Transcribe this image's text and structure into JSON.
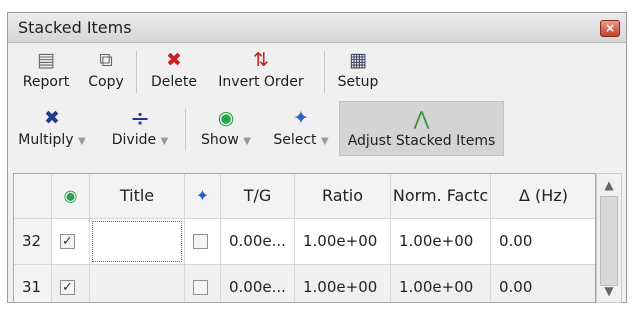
{
  "window": {
    "title": "Stacked Items",
    "close_glyph": "×"
  },
  "toolbar1": [
    {
      "label": "Report",
      "icon": "report-icon",
      "glyph": "▤"
    },
    {
      "label": "Copy",
      "icon": "copy-icon",
      "glyph": "⧉"
    },
    {
      "label": "Delete",
      "icon": "delete-icon",
      "glyph": "✖",
      "color": "#cc1f1f"
    },
    {
      "label": "Invert Order",
      "icon": "invert-order-icon",
      "glyph": "⇅",
      "color": "#c62020"
    },
    {
      "label": "Setup",
      "icon": "setup-icon",
      "glyph": "▦"
    }
  ],
  "toolbar2": [
    {
      "label": "Multiply",
      "icon": "multiply-icon",
      "glyph": "✖",
      "color": "#1f3c88",
      "dropdown": true
    },
    {
      "label": "Divide",
      "icon": "divide-icon",
      "glyph": "÷",
      "color": "#1f3c88",
      "dropdown": true
    },
    {
      "label": "Show",
      "icon": "eye-icon",
      "glyph": "◉",
      "color": "#2aa34a",
      "dropdown": true
    },
    {
      "label": "Select",
      "icon": "pin-icon",
      "glyph": "✦",
      "color": "#2c5cc5",
      "dropdown": true
    },
    {
      "label": "Adjust Stacked Items",
      "icon": "adjust-spectra-icon",
      "glyph": "⋀",
      "color": "#3a8a3a",
      "active": true
    }
  ],
  "dropdown_glyph": "▼",
  "table": {
    "headers": [
      "",
      "",
      "Title",
      "",
      "T/G",
      "Ratio",
      "Norm. Factc",
      "Δ (Hz)"
    ],
    "header_icons": {
      "visible": "eye-icon",
      "pin": "pin-icon"
    },
    "rows": [
      {
        "index": "32",
        "visible": true,
        "title": "",
        "pinned": false,
        "tg": "0.00e...",
        "ratio": "1.00e+00",
        "norm": "1.00e+00",
        "delta": "0.00"
      },
      {
        "index": "31",
        "visible": true,
        "title": "",
        "pinned": false,
        "tg": "0.00e...",
        "ratio": "1.00e+00",
        "norm": "1.00e+00",
        "delta": "0.00"
      }
    ]
  },
  "scrollbar": {
    "up_glyph": "▲",
    "down_glyph": "▼"
  },
  "colors": {
    "active_bg": "#d4d4d4",
    "grid_border": "#a8a8a8"
  }
}
